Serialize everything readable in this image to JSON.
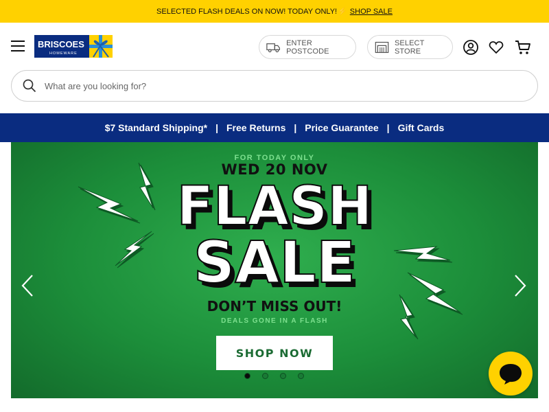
{
  "promo": {
    "text": "SELECTED FLASH DEALS ON NOW! TODAY ONLY!",
    "bolt": "⚡",
    "link": "SHOP SALE"
  },
  "header": {
    "logo_text": "BRISCOES",
    "logo_sub": "HOMEWARE",
    "postcode_label": "ENTER POSTCODE",
    "store_label": "SELECT STORE"
  },
  "search": {
    "placeholder": "What are you looking for?"
  },
  "usp": {
    "shipping": "$7 Standard Shipping*",
    "returns": "Free Returns",
    "price": "Price Guarantee",
    "gift": "Gift Cards",
    "separator": "|"
  },
  "hero": {
    "kicker": "FOR TODAY ONLY",
    "date": "WED 20 NOV",
    "line1": "FLASH",
    "line2": "SALE",
    "tagline": "DON’T MISS OUT!",
    "subtag": "DEALS GONE IN A FLASH",
    "cta": "SHOP NOW",
    "slide_count": 4,
    "active_slide": 1
  },
  "colors": {
    "promo_bg": "#ffd100",
    "usp_bg": "#0a2c80",
    "hero_green": "#1c8e3a",
    "accent_green": "#7de08f",
    "chat_bg": "#ffd100"
  },
  "icons": [
    "menu-icon",
    "truck-icon",
    "store-icon",
    "account-icon",
    "heart-icon",
    "cart-icon",
    "search-icon",
    "chevron-left-icon",
    "chevron-right-icon",
    "chat-icon",
    "lightning-bolt-icon"
  ]
}
